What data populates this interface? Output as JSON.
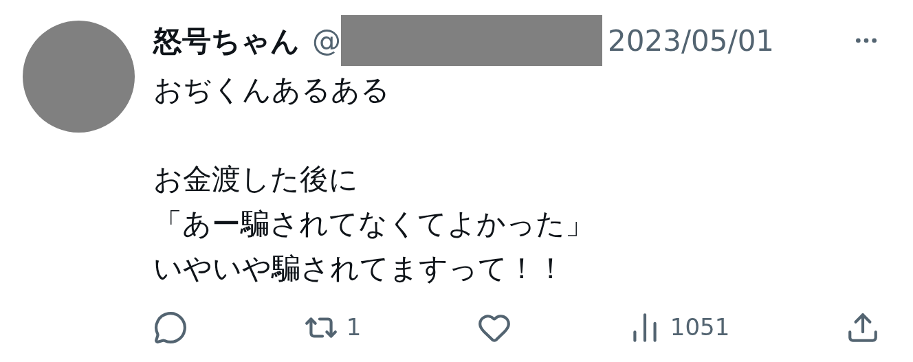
{
  "post": {
    "author": "怒号ちゃん",
    "handle_prefix": "@",
    "handle_redacted": true,
    "date": "2023/05/01",
    "paragraphs": [
      [
        "おぢくんあるある"
      ],
      [
        "お金渡した後に",
        "「あー騙されてなくてよかった」",
        "いやいや騙されてますって！！"
      ]
    ],
    "actions": [
      {
        "kind": "reply"
      },
      {
        "kind": "repost",
        "count": "1"
      },
      {
        "kind": "like"
      },
      {
        "kind": "views",
        "count": "1051"
      },
      {
        "kind": "share"
      }
    ]
  }
}
